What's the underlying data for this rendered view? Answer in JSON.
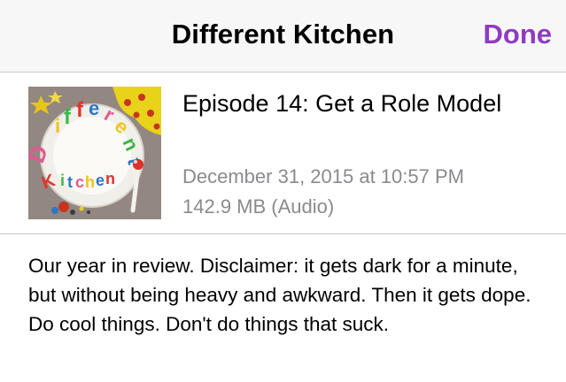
{
  "nav": {
    "title": "Different Kitchen",
    "done_label": "Done",
    "accent_color": "#8e3bc2"
  },
  "episode": {
    "artwork_icon": "podcast-artwork",
    "title": "Episode 14: Get a Role Model",
    "date": "December 31, 2015 at 10:57 PM",
    "size": "142.9 MB (Audio)",
    "description": "Our year in review. Disclaimer: it gets dark for a minute, but without being heavy and awkward. Then it gets dope. Do cool things. Don't do things that suck."
  }
}
